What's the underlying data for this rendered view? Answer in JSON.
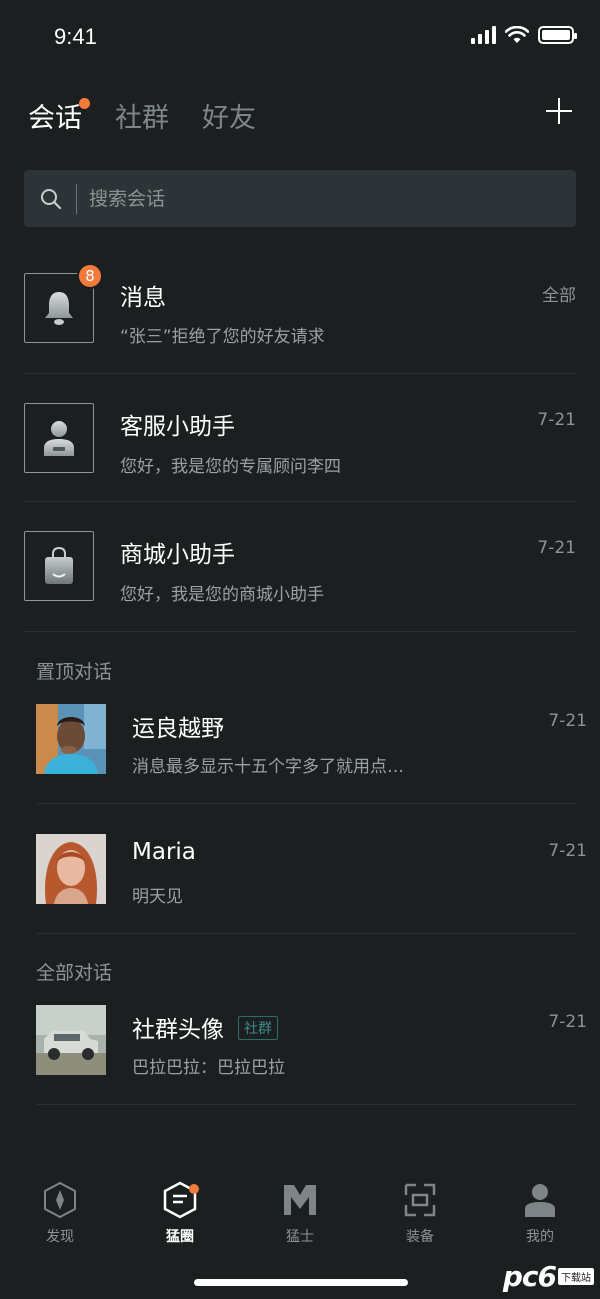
{
  "status_bar": {
    "time": "9:41"
  },
  "tabs": [
    {
      "label": "会话",
      "active": true,
      "has_dot": true
    },
    {
      "label": "社群",
      "active": false
    },
    {
      "label": "好友",
      "active": false
    }
  ],
  "search": {
    "placeholder": "搜索会话"
  },
  "system_rows": [
    {
      "title": "消息",
      "subtitle": "“张三”拒绝了您的好友请求",
      "time": "全部",
      "badge": "8",
      "icon": "bell-icon"
    },
    {
      "title": "客服小助手",
      "subtitle": "您好，我是您的专属顾问李四",
      "time": "7-21",
      "icon": "user-icon"
    },
    {
      "title": "商城小助手",
      "subtitle": "您好，我是您的商城小助手",
      "time": "7-21",
      "icon": "shopping-bag-icon"
    }
  ],
  "sections": {
    "pinned": "置顶对话",
    "all": "全部对话"
  },
  "pinned_rows": [
    {
      "title": "运良越野",
      "subtitle": "消息最多显示十五个字多了就用点…",
      "time": "7-21"
    },
    {
      "title": "Maria",
      "subtitle": "明天见",
      "time": "7-21"
    }
  ],
  "all_rows": [
    {
      "title": "社群头像",
      "tag": "社群",
      "subtitle": "巴拉巴拉：巴拉巴拉",
      "time": "7-21"
    }
  ],
  "bottom_nav": [
    {
      "label": "发现",
      "icon": "compass-icon",
      "active": false
    },
    {
      "label": "猛圈",
      "icon": "circle-hex-icon",
      "active": true,
      "has_dot": true
    },
    {
      "label": "猛士",
      "icon": "m-logo-icon",
      "active": false
    },
    {
      "label": "装备",
      "icon": "gear-box-icon",
      "active": false
    },
    {
      "label": "我的",
      "icon": "profile-icon",
      "active": false
    }
  ],
  "watermark": {
    "main": "pc6",
    "sub": "下载站"
  },
  "colors": {
    "background": "#1b1f20",
    "accent": "#f27a3a",
    "tag": "#3c8a8a"
  }
}
